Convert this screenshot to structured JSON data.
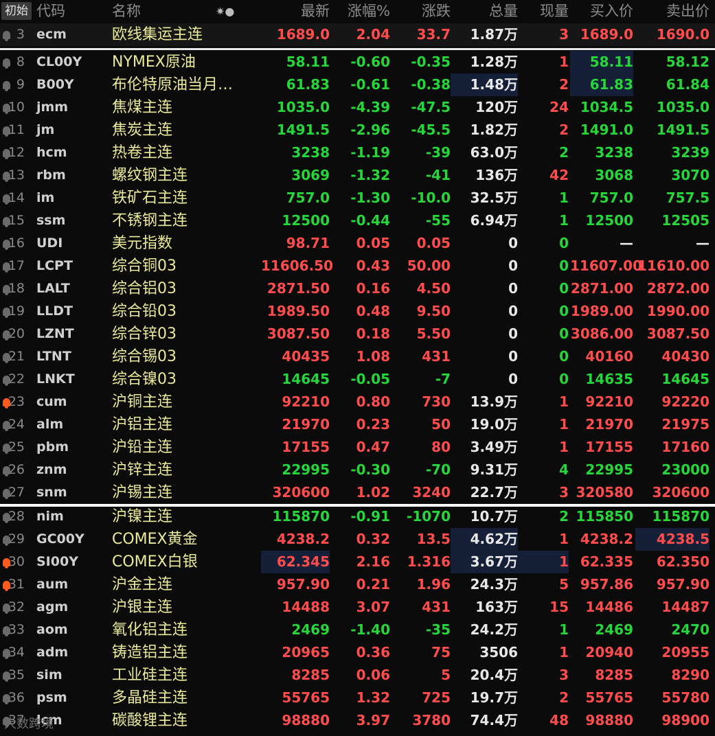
{
  "header": {
    "tag": "初始",
    "code": "代码",
    "name": "名称",
    "icons": "✷●",
    "last": "最新",
    "pct": "涨幅%",
    "chg": "涨跌",
    "vol": "总量",
    "cur": "现量",
    "bid": "买入价",
    "ask": "卖出价"
  },
  "top_row": {
    "idx": "3",
    "code": "ecm",
    "name": "欧线集运主连",
    "last": "1689.0",
    "pct": "2.04",
    "chg": "33.7",
    "vol": "1.87万",
    "cur": "3",
    "bid": "1689.0",
    "ask": "1690.0"
  },
  "rows": [
    {
      "idx": "8",
      "code": "CL00Y",
      "name": "NYMEX原油",
      "last": "58.11",
      "pct": "-0.60",
      "chg": "-0.35",
      "vol": "1.28万",
      "cur": "1",
      "bid": "58.11",
      "ask": "58.12"
    },
    {
      "idx": "9",
      "code": "B00Y",
      "name": "布伦特原油当月…",
      "last": "61.83",
      "pct": "-0.61",
      "chg": "-0.38",
      "vol": "1.48万",
      "cur": "2",
      "bid": "61.83",
      "ask": "61.84"
    },
    {
      "idx": "10",
      "code": "jmm",
      "name": "焦煤主连",
      "last": "1035.0",
      "pct": "-4.39",
      "chg": "-47.5",
      "vol": "120万",
      "cur": "24",
      "bid": "1034.5",
      "ask": "1035.0"
    },
    {
      "idx": "11",
      "code": "jm",
      "name": "焦炭主连",
      "last": "1491.5",
      "pct": "-2.96",
      "chg": "-45.5",
      "vol": "1.82万",
      "cur": "2",
      "bid": "1491.0",
      "ask": "1491.5"
    },
    {
      "idx": "12",
      "code": "hcm",
      "name": "热卷主连",
      "last": "3238",
      "pct": "-1.19",
      "chg": "-39",
      "vol": "63.0万",
      "cur": "2",
      "bid": "3238",
      "ask": "3239"
    },
    {
      "idx": "13",
      "code": "rbm",
      "name": "螺纹钢主连",
      "last": "3069",
      "pct": "-1.32",
      "chg": "-41",
      "vol": "136万",
      "cur": "42",
      "bid": "3068",
      "ask": "3070"
    },
    {
      "idx": "14",
      "code": "im",
      "name": "铁矿石主连",
      "last": "757.0",
      "pct": "-1.30",
      "chg": "-10.0",
      "vol": "32.5万",
      "cur": "1",
      "bid": "757.0",
      "ask": "757.5"
    },
    {
      "idx": "15",
      "code": "ssm",
      "name": "不锈钢主连",
      "last": "12500",
      "pct": "-0.44",
      "chg": "-55",
      "vol": "6.94万",
      "cur": "1",
      "bid": "12500",
      "ask": "12505"
    },
    {
      "idx": "16",
      "code": "UDI",
      "name": "美元指数",
      "last": "98.71",
      "pct": "0.05",
      "chg": "0.05",
      "vol": "0",
      "cur": "0",
      "bid": "—",
      "ask": "—"
    },
    {
      "idx": "17",
      "code": "LCPT",
      "name": "综合铜03",
      "last": "11606.50",
      "pct": "0.43",
      "chg": "50.00",
      "vol": "0",
      "cur": "0",
      "bid": "11607.00",
      "ask": "11610.00"
    },
    {
      "idx": "18",
      "code": "LALT",
      "name": "综合铝03",
      "last": "2871.50",
      "pct": "0.16",
      "chg": "4.50",
      "vol": "0",
      "cur": "0",
      "bid": "2871.00",
      "ask": "2872.00"
    },
    {
      "idx": "19",
      "code": "LLDT",
      "name": "综合铅03",
      "last": "1989.50",
      "pct": "0.48",
      "chg": "9.50",
      "vol": "0",
      "cur": "0",
      "bid": "1989.00",
      "ask": "1990.00"
    },
    {
      "idx": "20",
      "code": "LZNT",
      "name": "综合锌03",
      "last": "3087.50",
      "pct": "0.18",
      "chg": "5.50",
      "vol": "0",
      "cur": "0",
      "bid": "3086.00",
      "ask": "3087.50"
    },
    {
      "idx": "21",
      "code": "LTNT",
      "name": "综合锡03",
      "last": "40435",
      "pct": "1.08",
      "chg": "431",
      "vol": "0",
      "cur": "0",
      "bid": "40160",
      "ask": "40430"
    },
    {
      "idx": "22",
      "code": "LNKT",
      "name": "综合镍03",
      "last": "14645",
      "pct": "-0.05",
      "chg": "-7",
      "vol": "0",
      "cur": "0",
      "bid": "14635",
      "ask": "14645"
    },
    {
      "idx": "23",
      "code": "cum",
      "name": "沪铜主连",
      "last": "92210",
      "pct": "0.80",
      "chg": "730",
      "vol": "13.9万",
      "cur": "1",
      "bid": "92210",
      "ask": "92220"
    },
    {
      "idx": "24",
      "code": "alm",
      "name": "沪铝主连",
      "last": "21970",
      "pct": "0.23",
      "chg": "50",
      "vol": "19.0万",
      "cur": "1",
      "bid": "21970",
      "ask": "21975"
    },
    {
      "idx": "25",
      "code": "pbm",
      "name": "沪铅主连",
      "last": "17155",
      "pct": "0.47",
      "chg": "80",
      "vol": "3.49万",
      "cur": "1",
      "bid": "17155",
      "ask": "17160"
    },
    {
      "idx": "26",
      "code": "znm",
      "name": "沪锌主连",
      "last": "22995",
      "pct": "-0.30",
      "chg": "-70",
      "vol": "9.31万",
      "cur": "4",
      "bid": "22995",
      "ask": "23000"
    },
    {
      "idx": "27",
      "code": "snm",
      "name": "沪锡主连",
      "last": "320600",
      "pct": "1.02",
      "chg": "3240",
      "vol": "22.7万",
      "cur": "3",
      "bid": "320580",
      "ask": "320600"
    },
    {
      "idx": "28",
      "code": "nim",
      "name": "沪镍主连",
      "last": "115870",
      "pct": "-0.91",
      "chg": "-1070",
      "vol": "10.7万",
      "cur": "2",
      "bid": "115850",
      "ask": "115870"
    },
    {
      "idx": "29",
      "code": "GC00Y",
      "name": "COMEX黄金",
      "last": "4238.2",
      "pct": "0.32",
      "chg": "13.5",
      "vol": "4.62万",
      "cur": "1",
      "bid": "4238.2",
      "ask": "4238.5"
    },
    {
      "idx": "30",
      "code": "SI00Y",
      "name": "COMEX白银",
      "last": "62.345",
      "pct": "2.16",
      "chg": "1.316",
      "vol": "3.67万",
      "cur": "1",
      "bid": "62.335",
      "ask": "62.350"
    },
    {
      "idx": "31",
      "code": "aum",
      "name": "沪金主连",
      "last": "957.90",
      "pct": "0.21",
      "chg": "1.96",
      "vol": "24.3万",
      "cur": "5",
      "bid": "957.86",
      "ask": "957.90"
    },
    {
      "idx": "32",
      "code": "agm",
      "name": "沪银主连",
      "last": "14488",
      "pct": "3.07",
      "chg": "431",
      "vol": "163万",
      "cur": "15",
      "bid": "14486",
      "ask": "14487"
    },
    {
      "idx": "33",
      "code": "aom",
      "name": "氧化铝主连",
      "last": "2469",
      "pct": "-1.40",
      "chg": "-35",
      "vol": "24.2万",
      "cur": "1",
      "bid": "2469",
      "ask": "2470"
    },
    {
      "idx": "34",
      "code": "adm",
      "name": "铸造铝主连",
      "last": "20965",
      "pct": "0.36",
      "chg": "75",
      "vol": "3506",
      "cur": "1",
      "bid": "20940",
      "ask": "20955"
    },
    {
      "idx": "35",
      "code": "sim",
      "name": "工业硅主连",
      "last": "8285",
      "pct": "0.06",
      "chg": "5",
      "vol": "20.4万",
      "cur": "3",
      "bid": "8285",
      "ask": "8290"
    },
    {
      "idx": "36",
      "code": "psm",
      "name": "多晶硅主连",
      "last": "55765",
      "pct": "1.32",
      "chg": "725",
      "vol": "19.7万",
      "cur": "2",
      "bid": "55765",
      "ask": "55780"
    },
    {
      "idx": "37",
      "code": "lcm",
      "name": "碳酸锂主连",
      "last": "98880",
      "pct": "3.97",
      "chg": "3780",
      "vol": "74.4万",
      "cur": "48",
      "bid": "98880",
      "ask": "98900"
    }
  ],
  "watermark": "大数跨境",
  "colors": {
    "up": "#ff4d4d",
    "down": "#27d63a",
    "name": "#eaea9a",
    "highlight": "#152038",
    "bell_active": "#ff5a1f"
  }
}
